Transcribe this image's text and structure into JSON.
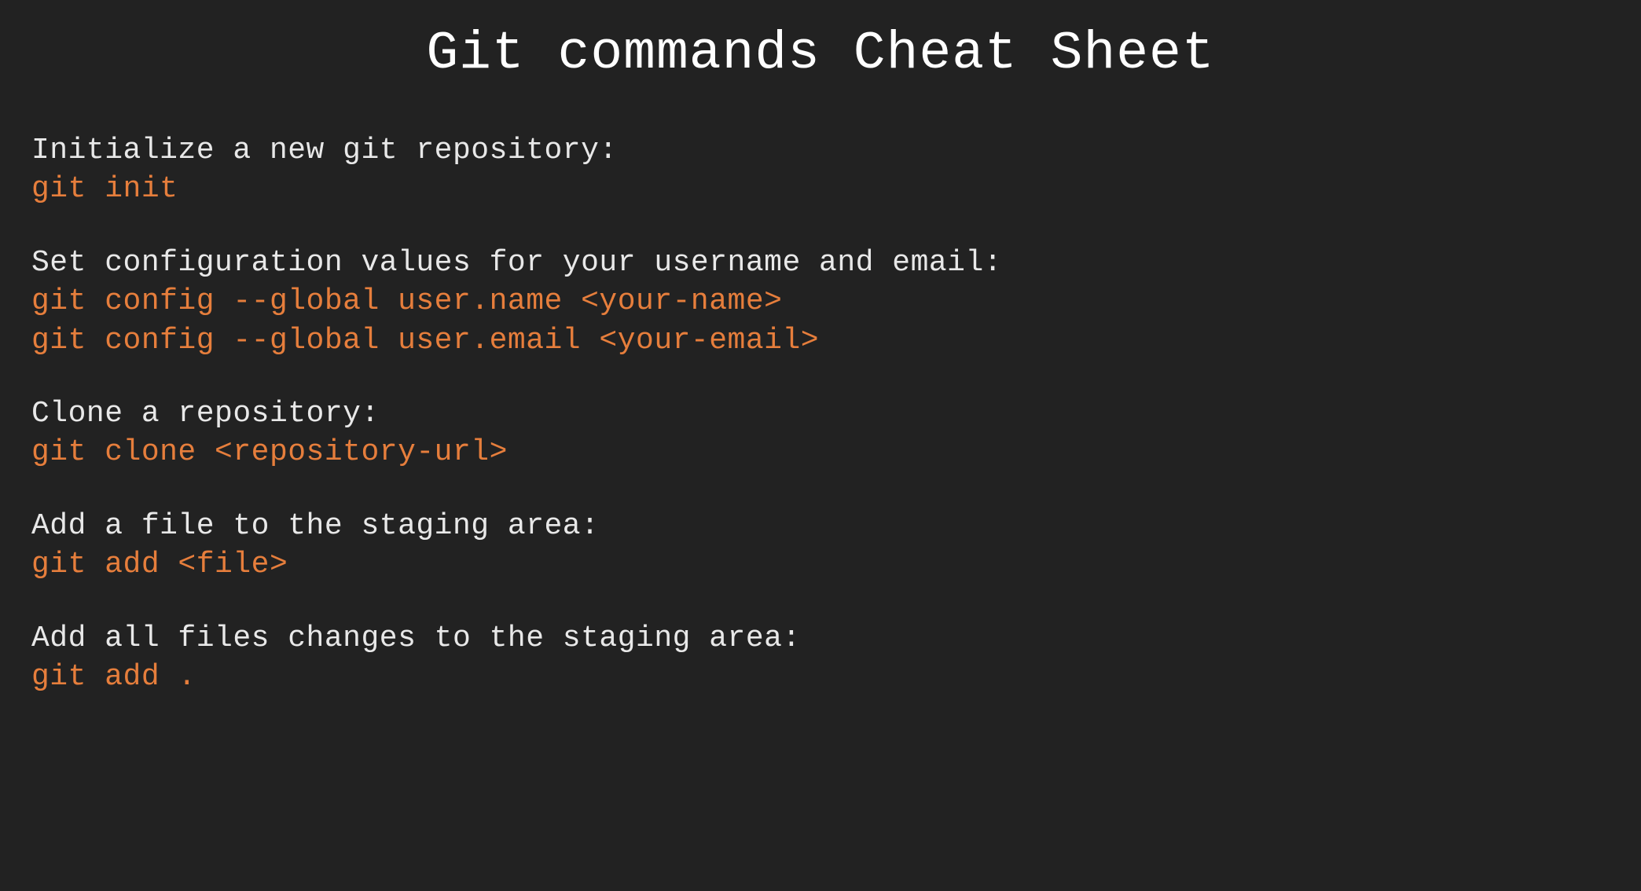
{
  "title": "Git commands Cheat Sheet",
  "sections": [
    {
      "description": "Initialize a new git repository:",
      "commands": [
        "git init"
      ]
    },
    {
      "description": "Set configuration values for your username and email:",
      "commands": [
        "git config --global user.name <your-name>",
        "git config --global user.email <your-email>"
      ]
    },
    {
      "description": "Clone a repository:",
      "commands": [
        "git clone <repository-url>"
      ]
    },
    {
      "description": "Add a file to the staging area:",
      "commands": [
        "git add <file>"
      ]
    },
    {
      "description": "Add all files changes to the staging area:",
      "commands": [
        "git add ."
      ]
    }
  ]
}
